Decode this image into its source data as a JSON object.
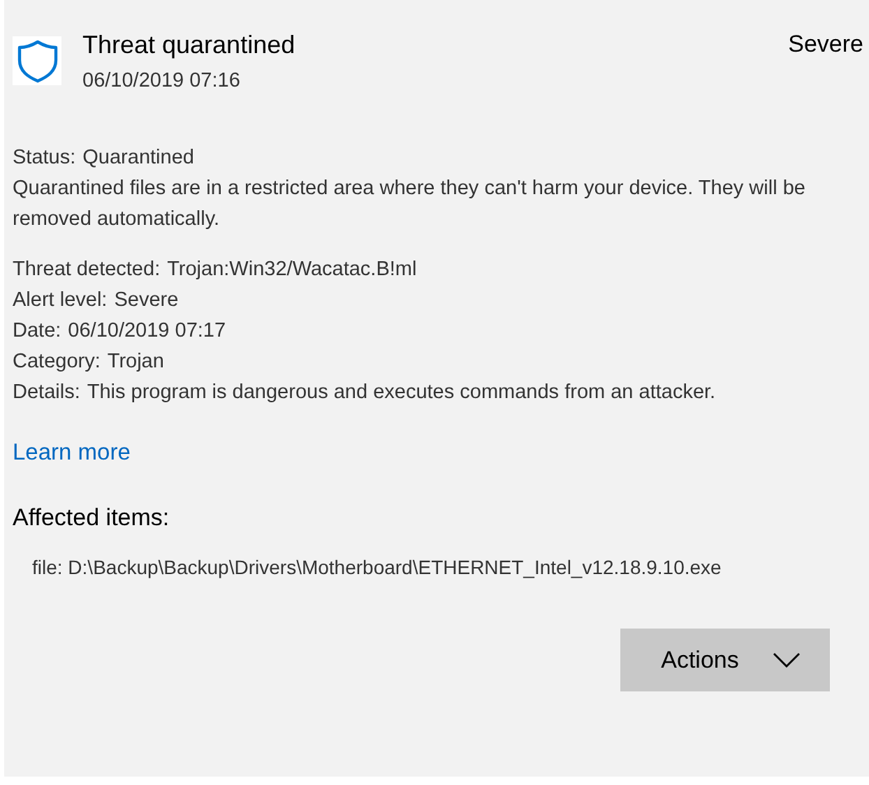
{
  "header": {
    "title": "Threat quarantined",
    "timestamp": "06/10/2019 07:16",
    "severity": "Severe"
  },
  "status": {
    "label": "Status:",
    "value": "Quarantined"
  },
  "status_description": "Quarantined files are in a restricted area where they can't harm your device. They will be removed automatically.",
  "details": [
    {
      "label": "Threat detected:",
      "value": "Trojan:Win32/Wacatac.B!ml"
    },
    {
      "label": "Alert level:",
      "value": "Severe"
    },
    {
      "label": "Date:",
      "value": "06/10/2019 07:17"
    },
    {
      "label": "Category:",
      "value": "Trojan"
    },
    {
      "label": "Details:",
      "value": "This program is dangerous and executes commands from an attacker."
    }
  ],
  "learn_more": "Learn more",
  "affected_items": {
    "heading": "Affected items:",
    "items": [
      "file: D:\\Backup\\Backup\\Drivers\\Motherboard\\ETHERNET_Intel_v12.18.9.10.exe"
    ]
  },
  "actions_button": "Actions"
}
